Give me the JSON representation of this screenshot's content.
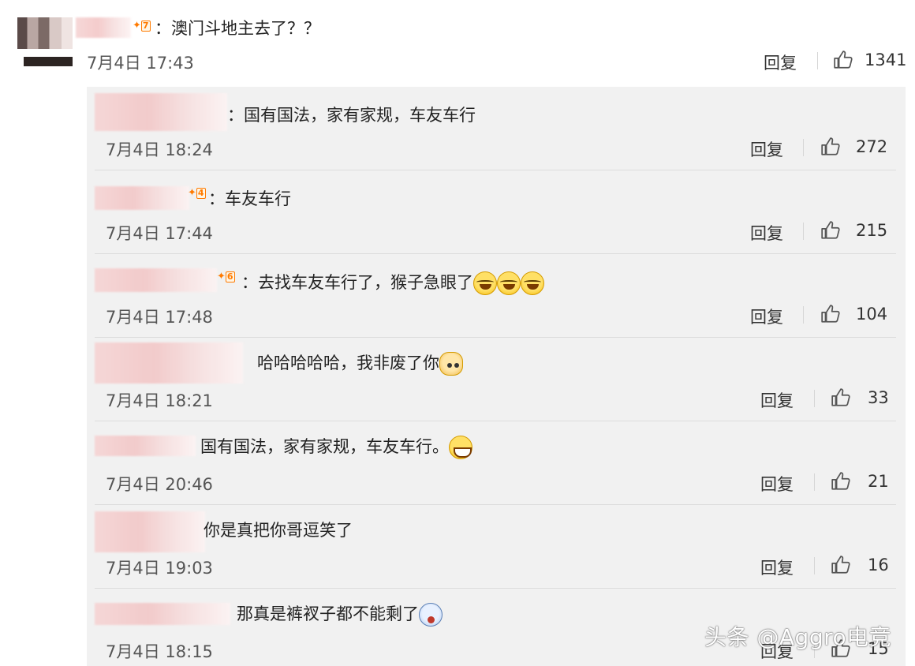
{
  "top_comment": {
    "text": "：澳门斗地主去了？？",
    "date": "7月4日 17:43",
    "reply_label": "回复",
    "likes": "1341",
    "vip_level": "7"
  },
  "replies": [
    {
      "text": "：国有国法，家有家规，车友车行",
      "date": "7月4日 18:24",
      "reply_label": "回复",
      "likes": "272"
    },
    {
      "text": "：车友车行",
      "date": "7月4日 17:44",
      "reply_label": "回复",
      "likes": "215",
      "vip_level": "4"
    },
    {
      "text": "：去找车友车行了，猴子急眼了",
      "date": "7月4日 17:48",
      "reply_label": "回复",
      "likes": "104",
      "vip_level": "6"
    },
    {
      "text": "哈哈哈哈哈，我非废了你",
      "date": "7月4日 18:21",
      "reply_label": "回复",
      "likes": "33"
    },
    {
      "text": "国有国法，家有家规，车友车行。",
      "date": "7月4日 20:46",
      "reply_label": "回复",
      "likes": "21"
    },
    {
      "text": "你是真把你哥逗笑了",
      "date": "7月4日 19:03",
      "reply_label": "回复",
      "likes": "16"
    },
    {
      "text": "那真是裤衩子都不能剩了",
      "date": "7月4日 18:15",
      "reply_label": "回复",
      "likes": "15"
    }
  ],
  "icons": {
    "like": "thumbs-up-icon",
    "emoji_laugh_cry": "laugh-cry-emoji-icon",
    "emoji_dog": "doge-emoji-icon",
    "emoji_grin": "grin-emoji-icon",
    "emoji_shock": "shock-emoji-icon",
    "vip_badge": "vip-level-badge-icon"
  },
  "watermark": "头条 @Aggro电竞",
  "colors": {
    "panel_bg": "#f1f1f1",
    "vip": "#ff7a00",
    "emoji": "#ffe066"
  }
}
